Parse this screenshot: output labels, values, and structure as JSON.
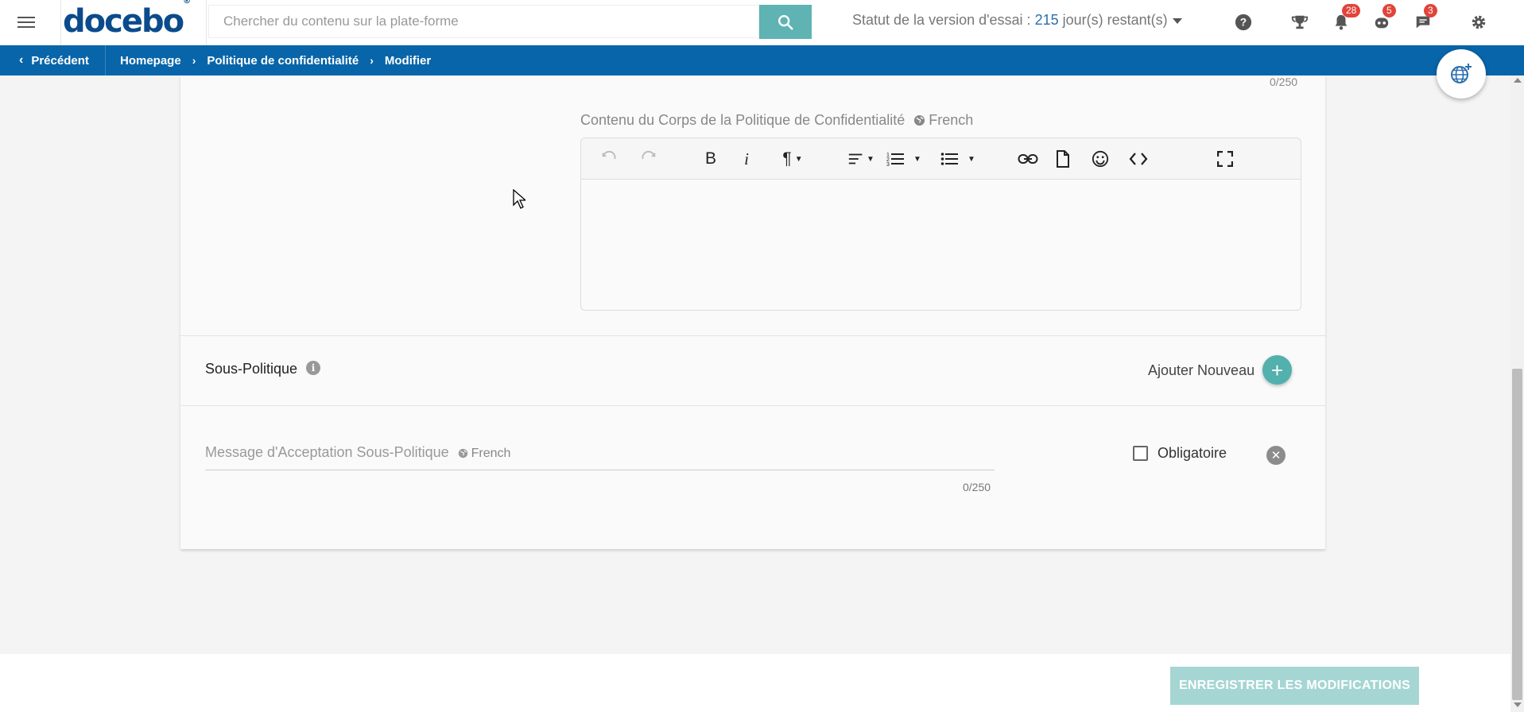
{
  "header": {
    "logo_text": "docebo",
    "search_placeholder": "Chercher du contenu sur la plate-forme",
    "trial_prefix": "Statut de la version d'essai : ",
    "trial_days": "215",
    "trial_suffix": " jour(s) restant(s)",
    "icons": [
      {
        "name": "help-icon"
      },
      {
        "name": "trophy-icon"
      },
      {
        "name": "bell-icon",
        "badge": "28"
      },
      {
        "name": "robot-icon",
        "badge": "5"
      },
      {
        "name": "chat-icon",
        "badge": "3"
      },
      {
        "name": "gear-icon"
      }
    ]
  },
  "breadcrumb": {
    "back_label": "Précédent",
    "items": [
      "Homepage",
      "Politique de confidentialité",
      "Modifier"
    ]
  },
  "form": {
    "top_counter": "0/250",
    "body_label": "Contenu du Corps de la Politique de Confidentialité",
    "language": "French",
    "toolbar": [
      "undo-icon",
      "redo-icon",
      "bold-icon",
      "italic-icon",
      "paragraph-icon",
      "align-icon",
      "ordered-list-icon",
      "bullet-list-icon",
      "link-icon",
      "file-icon",
      "emoji-icon",
      "code-icon",
      "fullscreen-icon"
    ],
    "sub_policy_title": "Sous-Politique",
    "add_new_label": "Ajouter Nouveau",
    "sub_message_label": "Message d'Acceptation Sous-Politique",
    "sub_language": "French",
    "sub_counter": "0/250",
    "mandatory_label": "Obligatoire",
    "mandatory_checked": false
  },
  "footer": {
    "save_label": "ENREGISTRER LES MODIFICATIONS"
  },
  "colors": {
    "brand_blue": "#0865a9",
    "teal": "#5fb3b3",
    "save_disabled": "#a5d6d3",
    "badge_red": "#e0443a"
  }
}
